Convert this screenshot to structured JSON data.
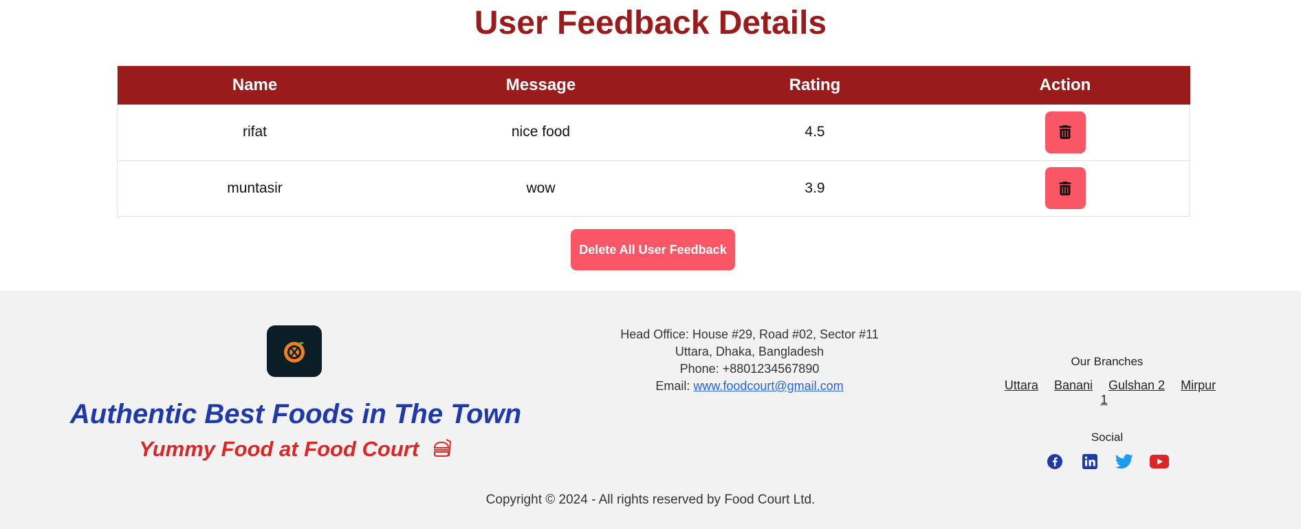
{
  "page_title": "User Feedback Details",
  "table": {
    "headers": [
      "Name",
      "Message",
      "Rating",
      "Action"
    ],
    "rows": [
      {
        "name": "rifat",
        "message": "nice food",
        "rating": "4.5"
      },
      {
        "name": "muntasir",
        "message": "wow",
        "rating": "3.9"
      }
    ]
  },
  "delete_all_label": "Delete All User Feedback",
  "footer": {
    "tagline": "Authentic Best Foods in The Town",
    "subtagline": "Yummy Food at Food Court",
    "contact": {
      "address_line1": "Head Office: House #29, Road #02, Sector #11",
      "address_line2": "Uttara, Dhaka, Bangladesh",
      "phone": "Phone: +8801234567890",
      "email_label": "Email: ",
      "email": "www.foodcourt@gmail.com"
    },
    "branches_title": "Our Branches",
    "branches": [
      "Uttara",
      "Banani",
      "Gulshan 2",
      "Mirpur 1"
    ],
    "social_title": "Social",
    "social_icons": [
      "facebook-icon",
      "linkedin-icon",
      "twitter-icon",
      "youtube-icon"
    ],
    "copyright": "Copyright © 2024 - All rights reserved by Food Court Ltd."
  },
  "colors": {
    "header_bg": "#991b1b",
    "button_bg": "#fa5766",
    "tagline": "#1e3aa8",
    "subtagline": "#dc2626",
    "footer_bg": "#f2f2f2"
  }
}
